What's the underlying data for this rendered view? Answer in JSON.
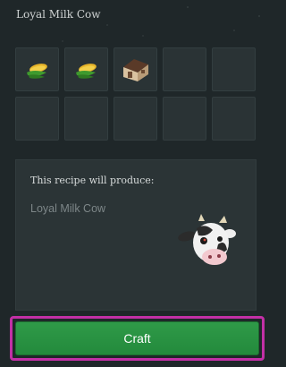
{
  "window": {
    "title": "Loyal Milk Cow"
  },
  "ingredients": {
    "slots": [
      {
        "icon": "corn-icon"
      },
      {
        "icon": "corn-icon"
      },
      {
        "icon": "barn-icon"
      },
      {
        "icon": ""
      },
      {
        "icon": ""
      },
      {
        "icon": ""
      },
      {
        "icon": ""
      },
      {
        "icon": ""
      },
      {
        "icon": ""
      },
      {
        "icon": ""
      }
    ]
  },
  "result": {
    "heading": "This recipe will produce:",
    "name": "Loyal Milk Cow",
    "icon": "cow-head-icon"
  },
  "craft": {
    "label": "Craft"
  },
  "colors": {
    "background": "#1f2729",
    "craft_button": "#2c9645",
    "highlight_border": "#c230a6"
  }
}
